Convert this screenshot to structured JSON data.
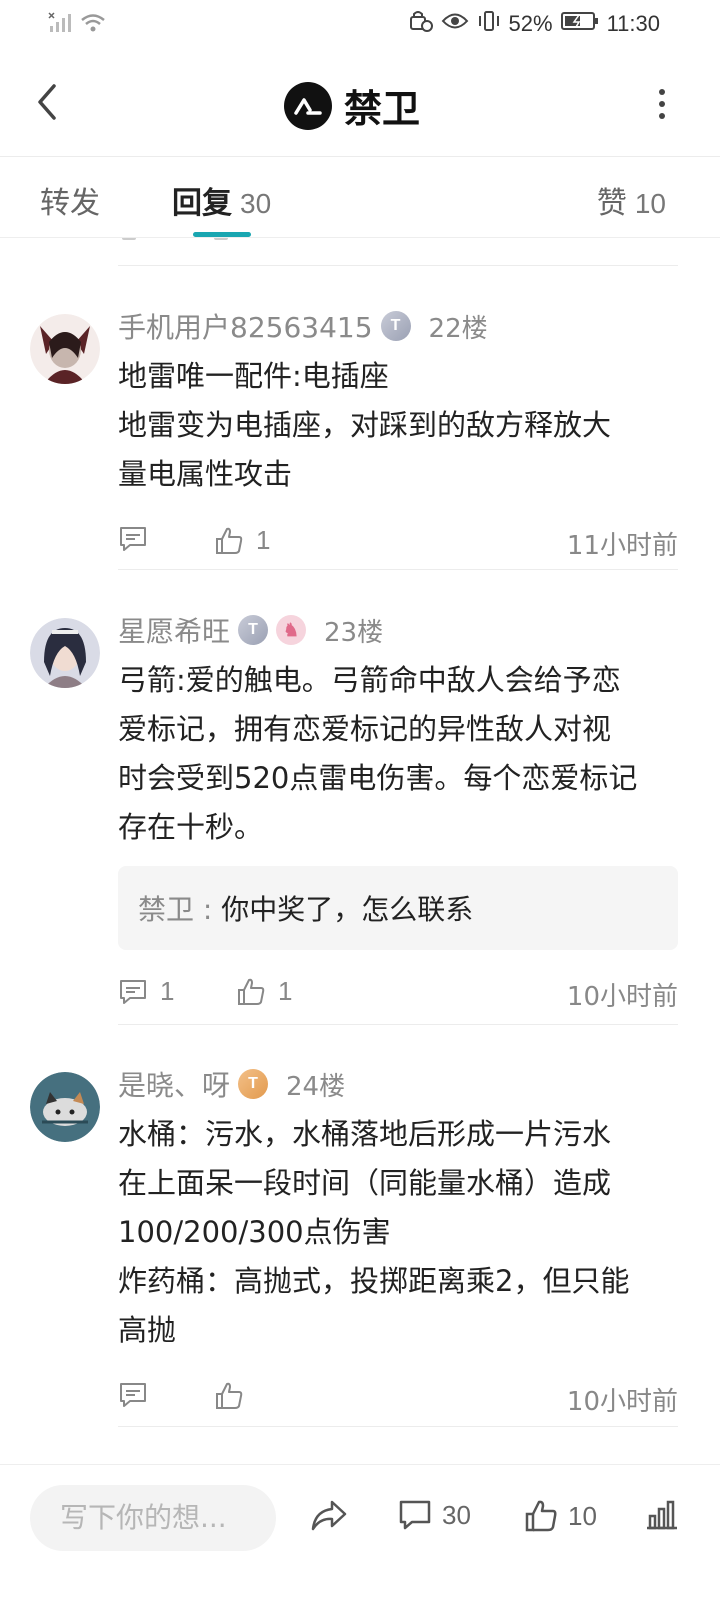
{
  "status_bar": {
    "battery_percent": "52%",
    "time": "11:30",
    "icons": [
      "signal-off-icon",
      "wifi-icon",
      "vpn-icon",
      "eye-icon",
      "vibrate-icon",
      "battery-icon"
    ]
  },
  "header": {
    "title": "禁卫",
    "icons": [
      "back-arrow-icon",
      "brand-logo-icon",
      "more-vertical-icon"
    ]
  },
  "tabs": [
    {
      "label": "转发",
      "count": "",
      "active": false
    },
    {
      "label": "回复",
      "count": "30",
      "active": true
    },
    {
      "label": "赞",
      "count": "10",
      "active": false
    }
  ],
  "comments": [
    {
      "user": "手机用户82563415",
      "badges": [
        {
          "kind": "silver",
          "glyph": "T"
        }
      ],
      "floor": "22楼",
      "text_lines": [
        "地雷唯一配件:电插座",
        "地雷变为电插座，对踩到的敌方释放大",
        "量电属性攻击"
      ],
      "quote": null,
      "reply_count": "",
      "like_count": "1",
      "time": "11小时前",
      "avatar_colors": [
        "#5a2326",
        "#c7b6ae"
      ]
    },
    {
      "user": "星愿希旺",
      "badges": [
        {
          "kind": "silver",
          "glyph": "T"
        },
        {
          "kind": "pink",
          "glyph": "♞"
        }
      ],
      "floor": "23楼",
      "text_lines": [
        "弓箭:爱的触电。弓箭命中敌人会给予恋",
        "爱标记，拥有恋爱标记的异性敌人对视",
        "时会受到520点雷电伤害。每个恋爱标记",
        "存在十秒。"
      ],
      "quote": {
        "user": "禁卫",
        "separator": " : ",
        "text": "你中奖了，怎么联系"
      },
      "reply_count": "1",
      "like_count": "1",
      "time": "10小时前",
      "avatar_colors": [
        "#2a2d3f",
        "#8e7e86"
      ]
    },
    {
      "user": "是晓、呀",
      "badges": [
        {
          "kind": "gold",
          "glyph": "T"
        }
      ],
      "floor": "24楼",
      "text_lines": [
        "水桶：污水，水桶落地后形成一片污水",
        "在上面呆一段时间（同能量水桶）造成",
        "100/200/300点伤害",
        "炸药桶：高抛式，投掷距离乘2，但只能",
        "高抛"
      ],
      "quote": null,
      "reply_count": "",
      "like_count": "",
      "time": "10小时前",
      "avatar_colors": [
        "#46707f",
        "#dcdcdc"
      ]
    }
  ],
  "bottom_bar": {
    "compose_placeholder": "写下你的想...",
    "comment_count": "30",
    "like_count": "10",
    "icons": [
      "share-icon",
      "comment-icon",
      "like-icon",
      "stats-icon"
    ]
  }
}
